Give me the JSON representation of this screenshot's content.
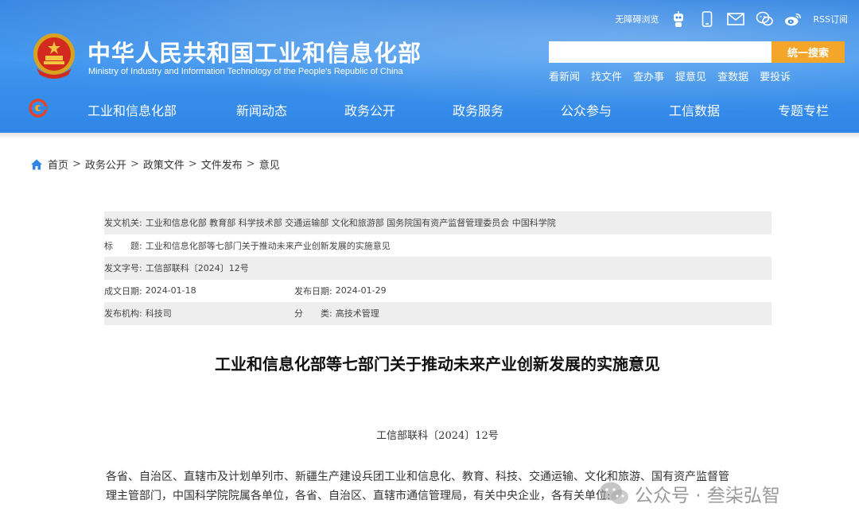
{
  "header": {
    "site_title": "中华人民共和国工业和信息化部",
    "site_subtitle": "Ministry of Industry and Information Technology of the People's Republic of China",
    "accessibility_link": "无障碍浏览",
    "rss_link": "RSS订阅",
    "search": {
      "placeholder": "",
      "button_label": "统一搜索"
    },
    "quick_links": [
      "看新闻",
      "找文件",
      "查办事",
      "提意见",
      "查数据",
      "要投诉"
    ]
  },
  "nav": {
    "items": [
      "工业和信息化部",
      "新闻动态",
      "政务公开",
      "政务服务",
      "公众参与",
      "工信数据",
      "专题专栏"
    ]
  },
  "breadcrumb": [
    "首页",
    "政务公开",
    "政策文件",
    "文件发布",
    "意见"
  ],
  "meta": {
    "issuing_org_label": "发文机关:",
    "issuing_org_value": "工业和信息化部 教育部 科学技术部 交通运输部 文化和旅游部 国务院国有资产监督管理委员会 中国科学院",
    "title_label": "标　　题:",
    "title_value": "工业和信息化部等七部门关于推动未来产业创新发展的实施意见",
    "doc_no_label": "发文字号:",
    "doc_no_value": "工信部联科〔2024〕12号",
    "written_date_label": "成文日期:",
    "written_date_value": "2024-01-18",
    "publish_date_label": "发布日期:",
    "publish_date_value": "2024-01-29",
    "org_label": "发布机构:",
    "org_value": "科技司",
    "category_label": "分　　类:",
    "category_value": "高技术管理"
  },
  "document": {
    "title": "工业和信息化部等七部门关于推动未来产业创新发展的实施意见",
    "number": "工信部联科〔2024〕12号",
    "para_line1": "各省、自治区、直辖市及计划单列市、新疆生产建设兵团工业和信息化、教育、科技、交通运输、文化和旅游、国有资产监督管",
    "para_line2": "理主管部门，中国科学院院属各单位，各省、自治区、直辖市通信管理局，有关中央企业，各有关单位:"
  },
  "watermark": {
    "text": "公众号 · 叁柒弘智"
  },
  "colors": {
    "header_blue": "#2f86e6",
    "search_button": "#f3a629",
    "meta_shade": "#eeeeee"
  }
}
